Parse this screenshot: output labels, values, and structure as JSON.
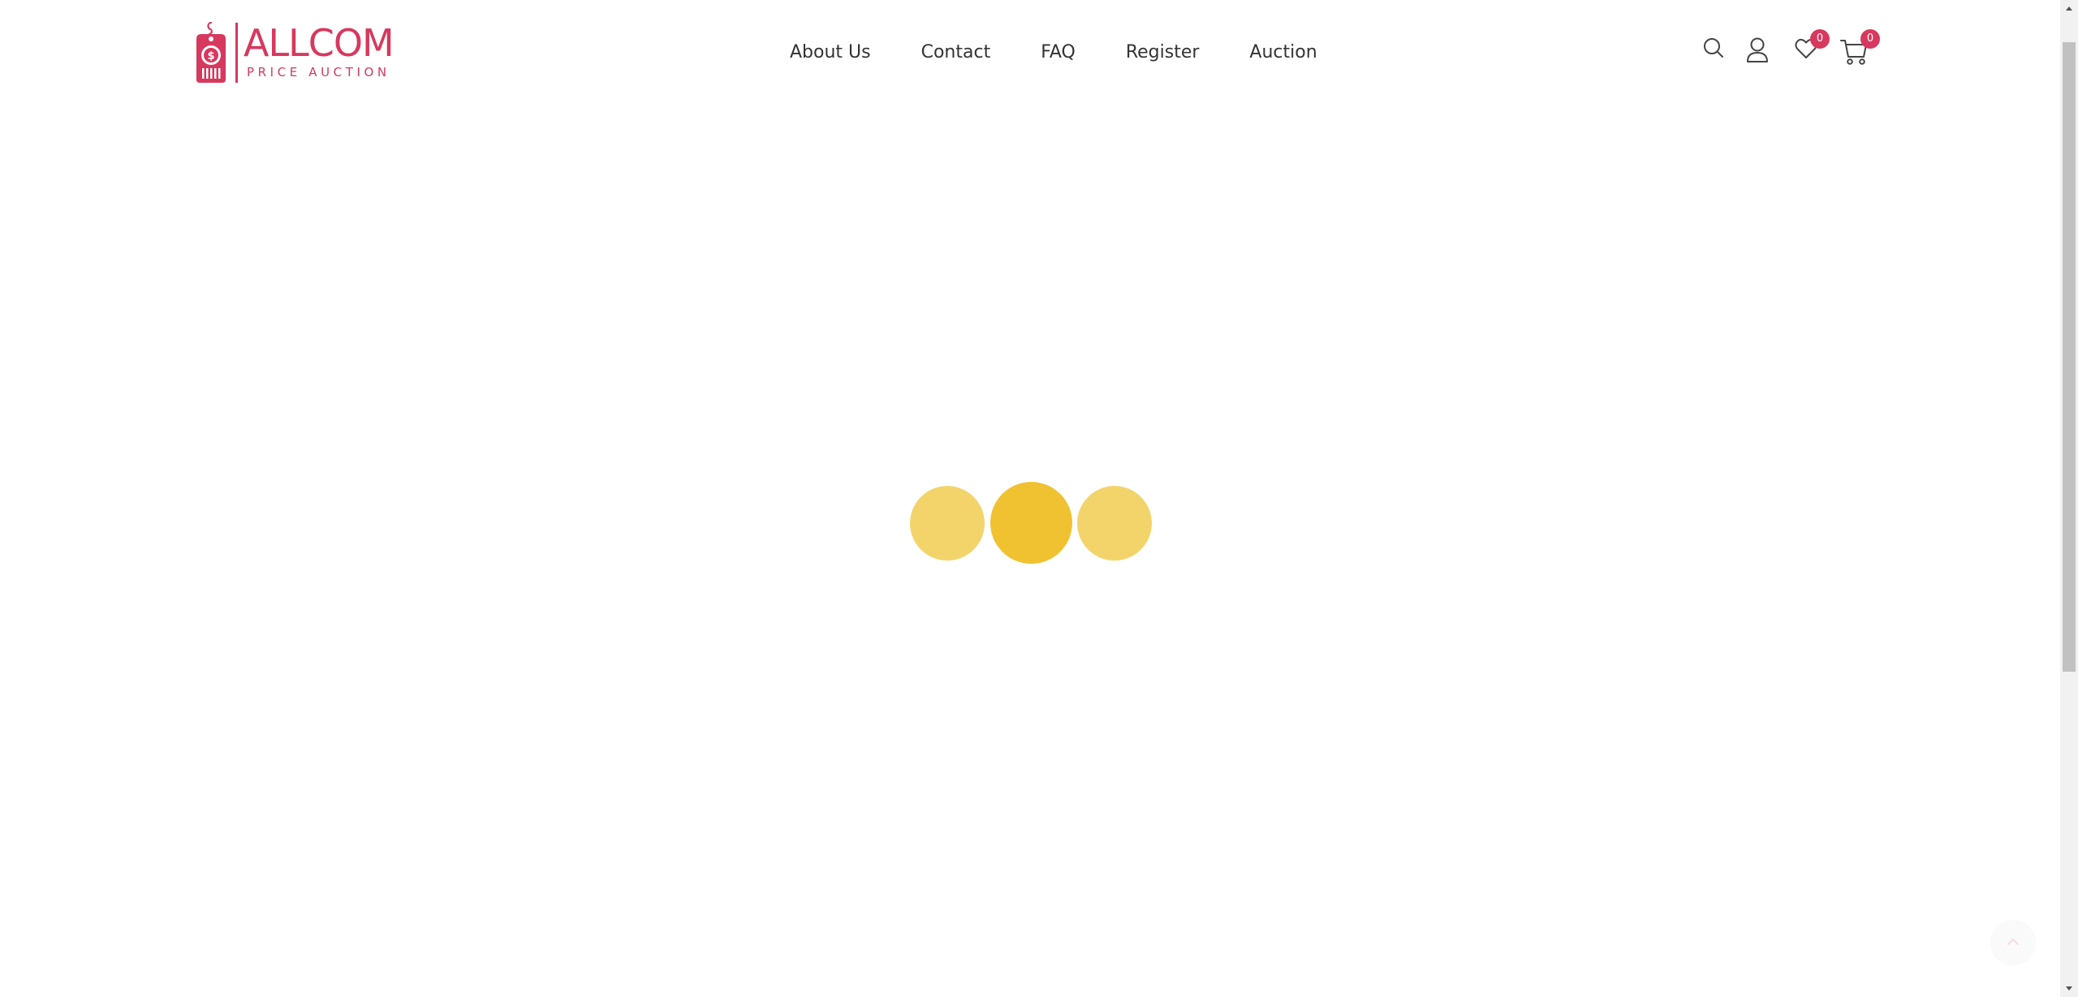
{
  "brand": {
    "name": "ALLCOM",
    "tagline": "PRICE AUCTION",
    "color": "#d7385e"
  },
  "nav": {
    "items": [
      {
        "label": "About Us"
      },
      {
        "label": "Contact"
      },
      {
        "label": "FAQ"
      },
      {
        "label": "Register"
      },
      {
        "label": "Auction"
      }
    ]
  },
  "header_icons": {
    "search": "search-icon",
    "account": "user-icon",
    "wishlist": {
      "icon": "heart-icon",
      "count": "0"
    },
    "cart": {
      "icon": "cart-icon",
      "count": "0"
    }
  },
  "loader": {
    "colors": {
      "primary": "#f0c232",
      "secondary": "#f3d46b"
    }
  },
  "scroll": {
    "back_to_top_icon": "arrow-up-icon"
  }
}
